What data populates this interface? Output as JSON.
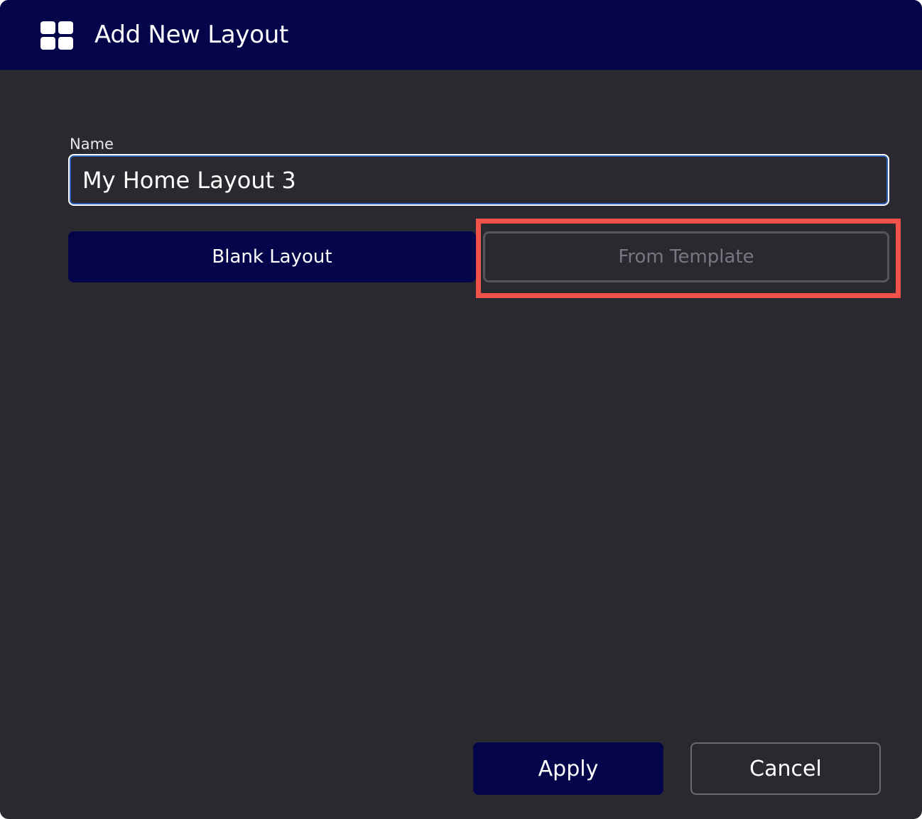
{
  "dialog": {
    "title": "Add New Layout",
    "title_icon": "layout-grid-icon"
  },
  "form": {
    "name_label": "Name",
    "name_value": "My Home Layout 3"
  },
  "layout_type": {
    "blank_label": "Blank Layout",
    "template_label": "From Template",
    "selected": "Blank Layout"
  },
  "footer": {
    "apply_label": "Apply",
    "cancel_label": "Cancel"
  },
  "colors": {
    "titlebar": "#03044a",
    "background": "#29292f",
    "primary_button": "#03044a",
    "input_focus": "#2b5fb8",
    "highlight": "#f0524a"
  }
}
